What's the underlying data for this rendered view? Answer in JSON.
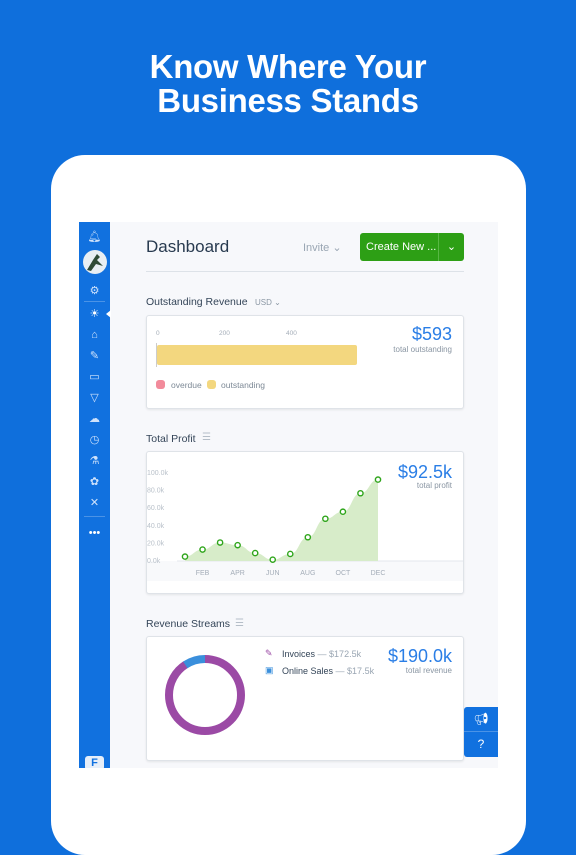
{
  "hero": {
    "line1": "Know Where Your",
    "line2": "Business Stands"
  },
  "header": {
    "title": "Dashboard",
    "invite_label": "Invite",
    "create_label": "Create New ..."
  },
  "sidebar": {
    "icons": [
      "bell-icon",
      "avatar",
      "gear-icon",
      "dashboard-sunrise-icon",
      "clients-hat-icon",
      "invoices-icon",
      "wallet-icon",
      "pizza-expenses-icon",
      "cloud-icon",
      "timer-icon",
      "flask-icon",
      "team-icon",
      "tools-icon",
      "more-icon"
    ],
    "more_label": "•••",
    "brand_letter": "F"
  },
  "outstanding": {
    "title": "Outstanding Revenue",
    "currency": "USD",
    "ticks": [
      "0",
      "200",
      "400"
    ],
    "amount": "$593",
    "amount_label": "total outstanding",
    "legend": [
      "overdue",
      "outstanding"
    ],
    "colors": {
      "overdue": "#f28b9b",
      "outstanding": "#f3d77f"
    },
    "value": 593,
    "overdue_value": 0
  },
  "profit": {
    "title": "Total Profit",
    "amount": "$92.5k",
    "amount_label": "total profit"
  },
  "revenue": {
    "title": "Revenue Streams",
    "amount": "$190.0k",
    "amount_label": "total revenue",
    "items": [
      {
        "name": "Invoices",
        "value": "$172.5k"
      },
      {
        "name": "Online Sales",
        "value": "$17.5k"
      }
    ],
    "colors": {
      "invoices": "#9b4aa5",
      "online_sales": "#3a8fdc"
    }
  },
  "chart_data": {
    "type": "area",
    "x": [
      "JAN",
      "FEB",
      "MAR",
      "APR",
      "MAY",
      "JUN",
      "JUL",
      "AUG",
      "SEP",
      "OCT",
      "NOV",
      "DEC"
    ],
    "x_tick_labels": [
      "FEB",
      "APR",
      "JUN",
      "AUG",
      "OCT",
      "DEC"
    ],
    "y_tick_labels": [
      "0.0k",
      "20.0k",
      "40.0k",
      "60.0k",
      "80.0k",
      "100.0k"
    ],
    "values": [
      5,
      13,
      21,
      18,
      9,
      1.5,
      8,
      27,
      48,
      56,
      77,
      92.5
    ],
    "ylim": [
      0,
      100
    ],
    "color": "#2fa51b"
  },
  "accent": "#1171df",
  "brand_green": "#2d9f15"
}
